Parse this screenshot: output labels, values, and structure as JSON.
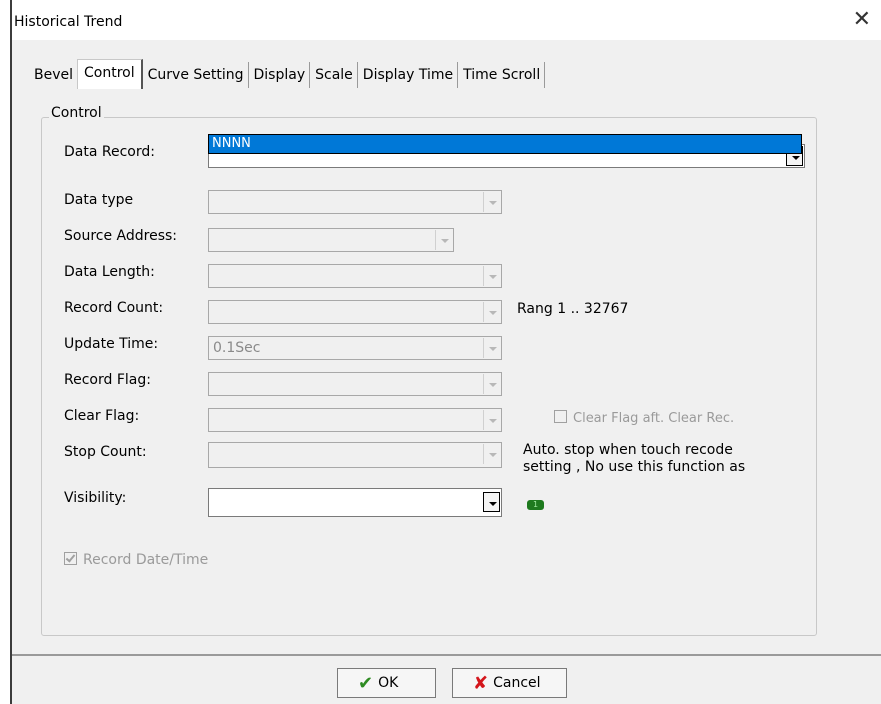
{
  "window": {
    "title": "Historical Trend",
    "close_glyph": "✕"
  },
  "tabs": [
    "Bevel",
    "Control",
    "Curve Setting",
    "Display",
    "Scale",
    "Display Time",
    "Time Scroll"
  ],
  "active_tab": "Control",
  "group": {
    "title": "Control"
  },
  "fields": {
    "data_record": {
      "label": "Data Record:",
      "value": ""
    },
    "data_type": {
      "label": "Data type",
      "value": ""
    },
    "source_address": {
      "label": "Source Address:",
      "value": ""
    },
    "data_length": {
      "label": "Data Length:",
      "value": ""
    },
    "record_count": {
      "label": "Record Count:",
      "value": "",
      "note": "Rang 1 .. 32767"
    },
    "update_time": {
      "label": "Update Time:",
      "value": "0.1Sec"
    },
    "record_flag": {
      "label": "Record Flag:",
      "value": ""
    },
    "clear_flag": {
      "label": "Clear Flag:",
      "value": "",
      "checkbox_label": "Clear Flag aft. Clear Rec."
    },
    "stop_count": {
      "label": "Stop Count:",
      "value": "",
      "note_line1": "Auto. stop when touch recode",
      "note_line2": "setting , No use this function as"
    },
    "visibility": {
      "label": "Visibility:",
      "value": "",
      "badge": "1"
    }
  },
  "dropdown": {
    "items": [
      "NNNN"
    ],
    "selected": "NNNN"
  },
  "record_datetime": {
    "label": "Record Date/Time",
    "checked": true
  },
  "buttons": {
    "ok": "OK",
    "cancel": "Cancel"
  },
  "colors": {
    "selection": "#0078d7",
    "ok_icon": "#2e8b22",
    "cancel_icon": "#d4151b",
    "badge": "#1e7a1e"
  }
}
